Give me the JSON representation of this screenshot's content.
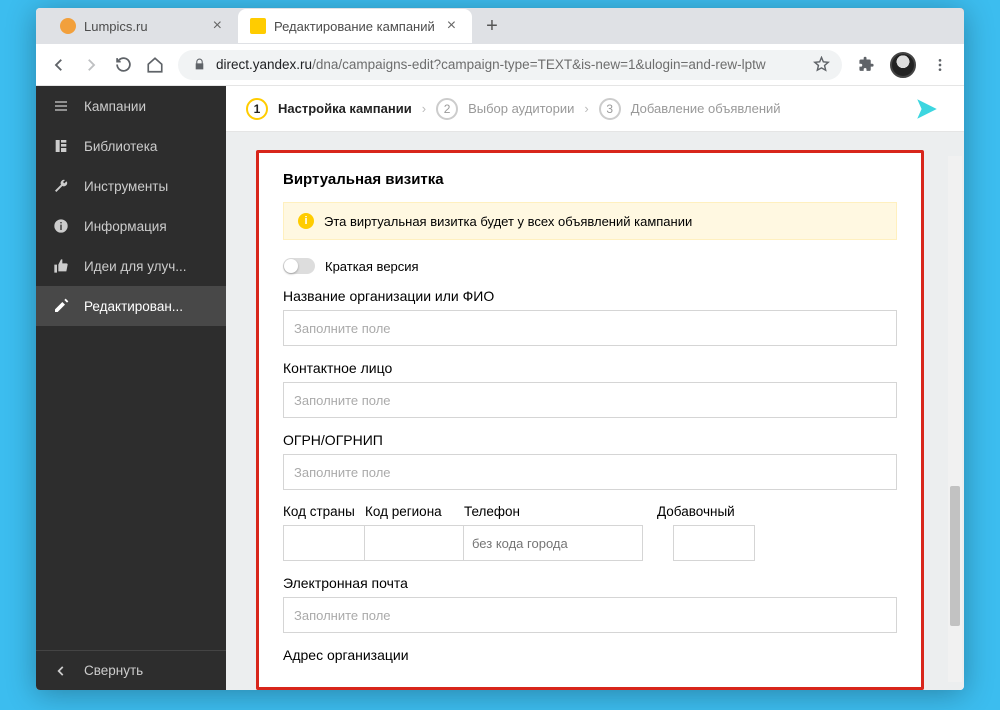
{
  "window": {
    "minimize_icon": "–",
    "maximize_icon": "□",
    "close_icon": "×"
  },
  "browser": {
    "tabs": [
      {
        "title": "Lumpics.ru",
        "favicon_color": "#f2a03c",
        "active": false
      },
      {
        "title": "Редактирование кампаний",
        "favicon_color": "#ffcc00",
        "active": true
      }
    ],
    "new_tab": "+",
    "url_host": "direct.yandex.ru",
    "url_path": "/dna/campaigns-edit?campaign-type=TEXT&is-new=1&ulogin=and-rew-lptw"
  },
  "sidebar": {
    "items": [
      {
        "label": "Кампании",
        "icon": "list"
      },
      {
        "label": "Библиотека",
        "icon": "book"
      },
      {
        "label": "Инструменты",
        "icon": "wrench"
      },
      {
        "label": "Информация",
        "icon": "info"
      },
      {
        "label": "Идеи для улуч...",
        "icon": "thumb"
      },
      {
        "label": "Редактирован...",
        "icon": "pencil",
        "active": true
      }
    ],
    "collapse": "Свернуть"
  },
  "steps": {
    "s1": {
      "num": "1",
      "label": "Настройка кампании"
    },
    "s2": {
      "num": "2",
      "label": "Выбор аудитории"
    },
    "s3": {
      "num": "3",
      "label": "Добавление объявлений"
    }
  },
  "card": {
    "title": "Виртуальная визитка",
    "notice": "Эта виртуальная визитка будет у всех объявлений кампании",
    "short_version": "Краткая версия",
    "org_label": "Название организации или ФИО",
    "contact_label": "Контактное лицо",
    "ogrn_label": "ОГРН/ОГРНИП",
    "placeholder": "Заполните поле",
    "phone": {
      "country": "Код страны",
      "region": "Код региона",
      "phone": "Телефон",
      "ext": "Добавочный",
      "phone_placeholder": "без кода города"
    },
    "email_label": "Электронная почта",
    "address_label": "Адрес организации"
  }
}
